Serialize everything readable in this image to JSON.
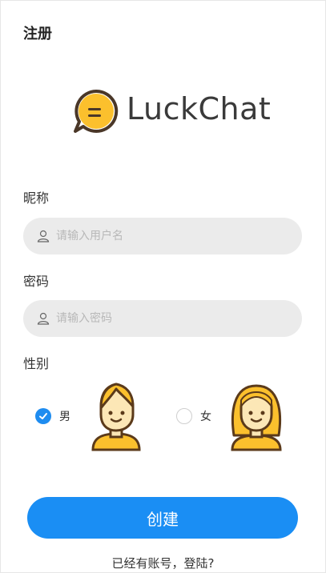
{
  "page": {
    "title": "注册"
  },
  "logo": {
    "text": "LuckChat"
  },
  "nickname": {
    "label": "昵称",
    "placeholder": "请输入用户名",
    "value": ""
  },
  "password": {
    "label": "密码",
    "placeholder": "请输入密码",
    "value": ""
  },
  "gender": {
    "label": "性别",
    "options": [
      {
        "label": "男",
        "selected": true
      },
      {
        "label": "女",
        "selected": false
      }
    ]
  },
  "actions": {
    "create_label": "创建",
    "login_link": "已经有账号，登陆?"
  },
  "colors": {
    "primary": "#1a8ef4",
    "field_bg": "#ebebeb",
    "avatar_yellow": "#fbc02d",
    "outline": "#5b3a1a"
  }
}
